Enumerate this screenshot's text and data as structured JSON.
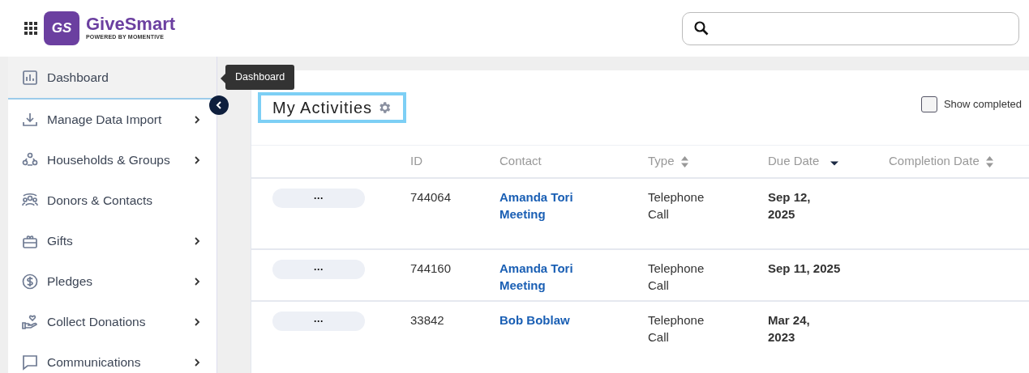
{
  "header": {
    "logo_mark": "GS",
    "brand": "GiveSmart",
    "tagline": "POWERED BY MOMENTIVE"
  },
  "sidebar": {
    "items": [
      {
        "label": "Dashboard",
        "selected": true,
        "expandable": false
      },
      {
        "label": "Manage Data Import",
        "selected": false,
        "expandable": true
      },
      {
        "label": "Households & Groups",
        "selected": false,
        "expandable": true
      },
      {
        "label": "Donors & Contacts",
        "selected": false,
        "expandable": false
      },
      {
        "label": "Gifts",
        "selected": false,
        "expandable": true
      },
      {
        "label": "Pledges",
        "selected": false,
        "expandable": true
      },
      {
        "label": "Collect Donations",
        "selected": false,
        "expandable": true
      },
      {
        "label": "Communications",
        "selected": false,
        "expandable": true
      }
    ],
    "tooltip": "Dashboard"
  },
  "page": {
    "title": "My Activities",
    "show_completed": {
      "label": "Show completed",
      "checked": false
    }
  },
  "table": {
    "columns": [
      {},
      {
        "label": "ID"
      },
      {
        "label": "Contact"
      },
      {
        "label": "Type",
        "sortable": true,
        "sorted": false
      },
      {
        "label": "Due Date",
        "sortable": true,
        "sorted": true
      },
      {
        "label": "Completion Date",
        "sortable": true,
        "sorted": false
      }
    ],
    "rows": [
      {
        "action": "···",
        "id": "744064",
        "contact": "Amanda Tori Meeting",
        "type": "Telephone Call",
        "due_date": "Sep 12, 2025"
      },
      {
        "action": "···",
        "id": "744160",
        "contact": "Amanda Tori Meeting",
        "type": "Telephone Call",
        "due_date": "Sep 11, 2025"
      },
      {
        "action": "···",
        "id": "33842",
        "contact": "Bob Boblaw",
        "type": "Telephone Call",
        "due_date": "Mar 24, 2023"
      }
    ]
  }
}
